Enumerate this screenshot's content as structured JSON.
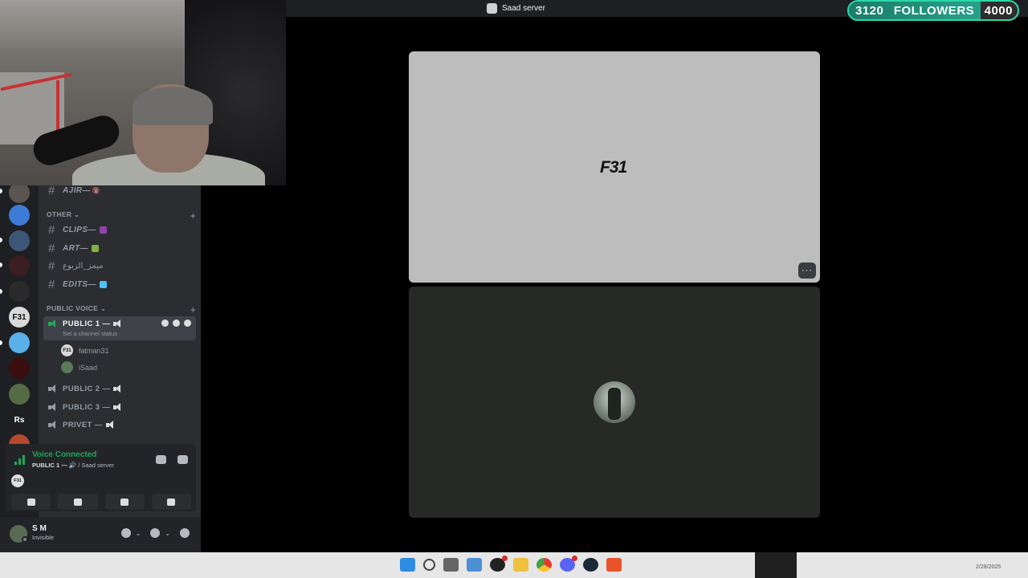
{
  "window": {
    "title": "Saad server"
  },
  "sidebar": {
    "top_channel": {
      "name": "AJIR—",
      "emoji": "🔞"
    },
    "categories": [
      {
        "label": "OTHER",
        "chevron": "⌄",
        "add": "+"
      },
      {
        "label": "PUBLIC VOICE",
        "chevron": "⌄",
        "add": "+"
      }
    ],
    "text_channels": [
      {
        "name": "CLIPS—",
        "emoji_color": "#8e44ad"
      },
      {
        "name": "ART—",
        "emoji_color": "#7cb342"
      },
      {
        "name": "ميمز_الزبوع",
        "emoji_color": ""
      },
      {
        "name": "EDITS—",
        "emoji_color": "#4fc3f7"
      }
    ],
    "voice_channels": [
      {
        "name": "PUBLIC 1 —",
        "status": "Set a channel status"
      },
      {
        "name": "PUBLIC 2 —"
      },
      {
        "name": "PUBLIC 3 —"
      },
      {
        "name": "PRIVET —"
      }
    ],
    "members": [
      {
        "name": "fatman31",
        "initials": "F31"
      },
      {
        "name": "iSaad",
        "initials": ""
      }
    ]
  },
  "server_rail": {
    "items": [
      {
        "label": "",
        "color": "#5a5550"
      },
      {
        "label": "",
        "color": "#3e7bd6"
      },
      {
        "label": "",
        "color": "#3d5678"
      },
      {
        "label": "",
        "color": "#3a1e22"
      },
      {
        "label": "",
        "color": "#2a2a2a"
      },
      {
        "label": "F31",
        "color": "#d9d9d9"
      },
      {
        "label": "",
        "color": "#5ab0e8"
      },
      {
        "label": "",
        "color": "#3a0e0e"
      },
      {
        "label": "",
        "color": "#556b44"
      },
      {
        "label": "Rs",
        "color": "#1e1f22"
      },
      {
        "label": "",
        "color": "#b5482e"
      }
    ]
  },
  "voice_panel": {
    "status": "Voice Connected",
    "channel": "PUBLIC 1 —",
    "server": "/ Saad server",
    "avatar_initials": "F31"
  },
  "user": {
    "name": "S M",
    "status": "Invisible"
  },
  "stage": {
    "tile1_logo": "F31",
    "more_button": "···"
  },
  "stream_overlay": {
    "followers_current": "3120",
    "followers_label": "FOLLOWERS",
    "followers_goal": "4000",
    "followers_progress": 0.78,
    "date": "2/28/2025"
  },
  "colors": {
    "accent_green": "#23a55a",
    "followers_border": "#2bd9a8"
  }
}
